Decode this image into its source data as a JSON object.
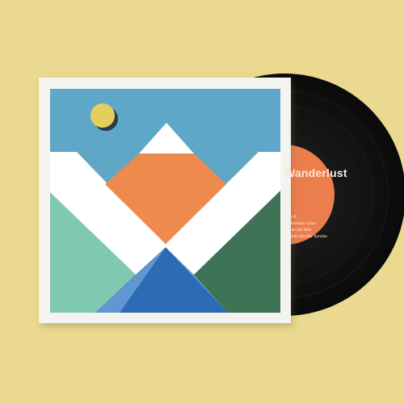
{
  "colors": {
    "background": "#ead98f",
    "sleeve": "#f4f3ef",
    "sky": "#5fa7c6",
    "sun": "#e3cf5a",
    "sun_shadow": "#2f3b44",
    "snow": "#ffffff",
    "peak_orange": "#ee8a4e",
    "hill_left": "#7fc9b2",
    "hill_right": "#3e7355",
    "lake": "#2d6bb5",
    "lake_highlight": "#6a9fd6",
    "vinyl": "#141414",
    "record_label": "#ec7e4e"
  },
  "record_label": {
    "title": "Wanderlust",
    "lines": [
      "Side A",
      "1. Mountain Drive",
      "2. Into the Wild",
      "3. Walk Into the Sunrise"
    ]
  }
}
